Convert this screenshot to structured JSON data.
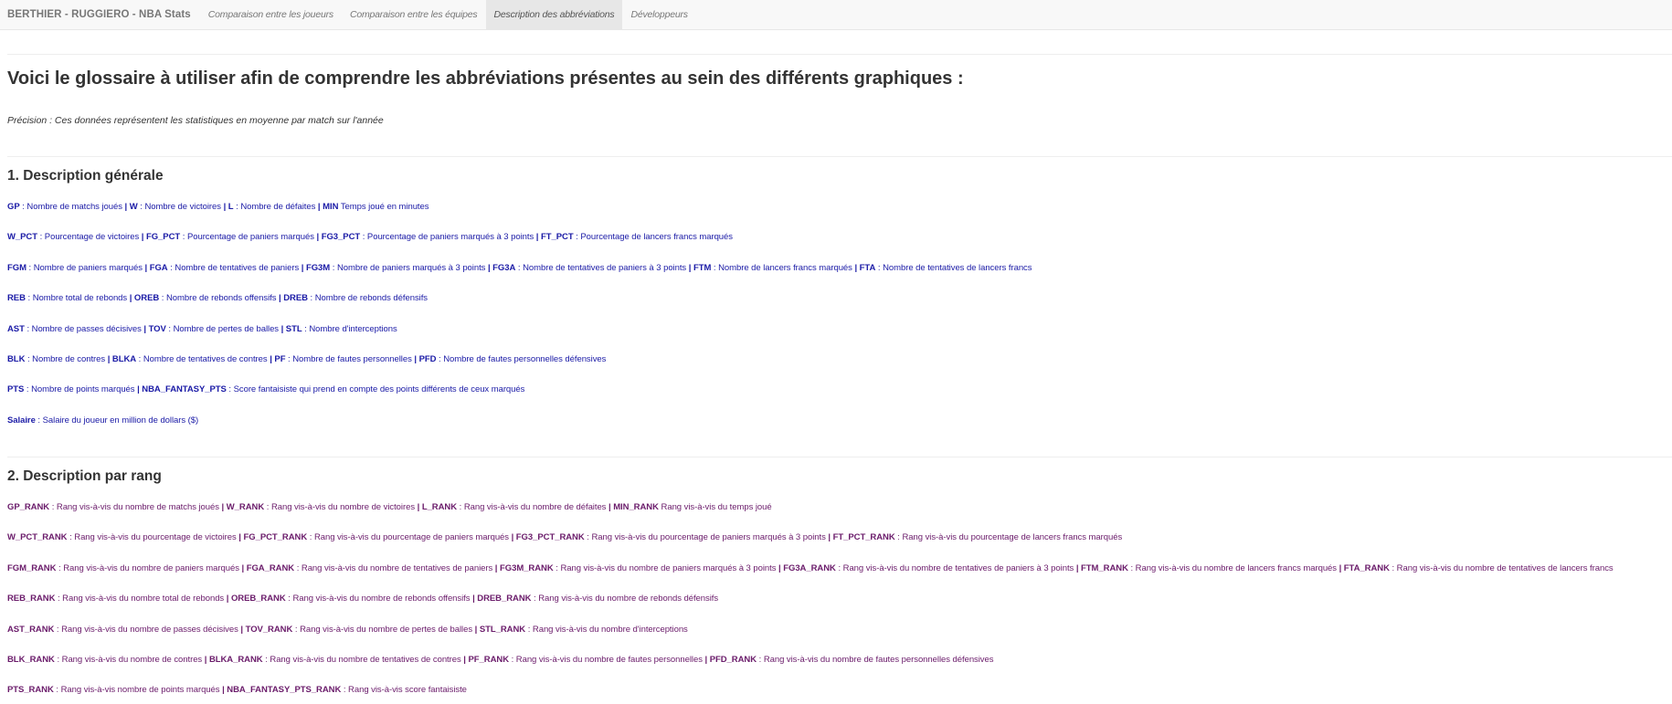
{
  "navbar": {
    "brand": "BERTHIER - RUGGIERO - NBA Stats",
    "tabs": [
      {
        "label": "Comparaison entre les joueurs",
        "active": false
      },
      {
        "label": "Comparaison entre les équipes",
        "active": false
      },
      {
        "label": "Description des abbréviations",
        "active": true
      },
      {
        "label": "Développeurs",
        "active": false
      }
    ]
  },
  "page": {
    "title": "Voici le glossaire à utiliser afin de comprendre les abbréviations présentes au sein des différents graphiques :",
    "precision": "Précision : Ces données représentent les statistiques en moyenne par match sur l'année"
  },
  "section1": {
    "title": "1. Description générale",
    "lines": [
      [
        {
          "abbr": "GP",
          "sep": " : ",
          "desc": "Nombre de matchs joués"
        },
        {
          "abbr": "W",
          "sep": " : ",
          "desc": "Nombre de victoires"
        },
        {
          "abbr": "L",
          "sep": " : ",
          "desc": "Nombre de défaites"
        },
        {
          "abbr": "MIN",
          "sep": " ",
          "desc": "Temps joué en minutes"
        }
      ],
      [
        {
          "abbr": "W_PCT",
          "sep": " : ",
          "desc": "Pourcentage de victoires"
        },
        {
          "abbr": "FG_PCT",
          "sep": " : ",
          "desc": "Pourcentage de paniers marqués"
        },
        {
          "abbr": "FG3_PCT",
          "sep": " : ",
          "desc": "Pourcentage de paniers marqués à 3 points"
        },
        {
          "abbr": "FT_PCT",
          "sep": " : ",
          "desc": "Pourcentage de lancers francs marqués"
        }
      ],
      [
        {
          "abbr": "FGM",
          "sep": " : ",
          "desc": "Nombre de paniers marqués"
        },
        {
          "abbr": "FGA",
          "sep": " : ",
          "desc": "Nombre de tentatives de paniers"
        },
        {
          "abbr": "FG3M",
          "sep": " : ",
          "desc": "Nombre de paniers marqués à 3 points"
        },
        {
          "abbr": "FG3A",
          "sep": " : ",
          "desc": "Nombre de tentatives de paniers à 3 points"
        },
        {
          "abbr": "FTM",
          "sep": " : ",
          "desc": "Nombre de lancers francs marqués"
        },
        {
          "abbr": "FTA",
          "sep": " : ",
          "desc": "Nombre de tentatives de lancers francs"
        }
      ],
      [
        {
          "abbr": "REB",
          "sep": " : ",
          "desc": "Nombre total de rebonds"
        },
        {
          "abbr": "OREB",
          "sep": " : ",
          "desc": "Nombre de rebonds offensifs"
        },
        {
          "abbr": "DREB",
          "sep": " : ",
          "desc": "Nombre de rebonds défensifs"
        }
      ],
      [
        {
          "abbr": "AST",
          "sep": " : ",
          "desc": "Nombre de passes décisives"
        },
        {
          "abbr": "TOV",
          "sep": " : ",
          "desc": "Nombre de pertes de balles"
        },
        {
          "abbr": "STL",
          "sep": " : ",
          "desc": "Nombre d'interceptions"
        }
      ],
      [
        {
          "abbr": "BLK",
          "sep": " : ",
          "desc": "Nombre de contres"
        },
        {
          "abbr": "BLKA",
          "sep": " : ",
          "desc": "Nombre de tentatives de contres"
        },
        {
          "abbr": "PF",
          "sep": " : ",
          "desc": "Nombre de fautes personnelles"
        },
        {
          "abbr": "PFD",
          "sep": " : ",
          "desc": "Nombre de fautes personnelles défensives"
        }
      ],
      [
        {
          "abbr": "PTS",
          "sep": " : ",
          "desc": "Nombre de points marqués"
        },
        {
          "abbr": "NBA_FANTASY_PTS",
          "sep": " : ",
          "desc": "Score fantaisiste qui prend en compte des points différents de ceux marqués"
        }
      ],
      [
        {
          "abbr": "Salaire",
          "sep": " : ",
          "desc": "Salaire du joueur en million de dollars ($)"
        }
      ]
    ]
  },
  "section2": {
    "title": "2. Description par rang",
    "lines": [
      [
        {
          "abbr": "GP_RANK",
          "sep": " : ",
          "desc": "Rang vis-à-vis du nombre de matchs joués"
        },
        {
          "abbr": "W_RANK",
          "sep": " : ",
          "desc": "Rang vis-à-vis du nombre de victoires"
        },
        {
          "abbr": "L_RANK",
          "sep": " : ",
          "desc": "Rang vis-à-vis du nombre de défaites"
        },
        {
          "abbr": "MIN_RANK",
          "sep": " ",
          "desc": "Rang vis-à-vis du temps joué"
        }
      ],
      [
        {
          "abbr": "W_PCT_RANK",
          "sep": " : ",
          "desc": "Rang vis-à-vis du pourcentage de victoires"
        },
        {
          "abbr": "FG_PCT_RANK",
          "sep": " : ",
          "desc": "Rang vis-à-vis du pourcentage de paniers marqués"
        },
        {
          "abbr": "FG3_PCT_RANK",
          "sep": " : ",
          "desc": "Rang vis-à-vis du pourcentage de paniers marqués à 3 points"
        },
        {
          "abbr": "FT_PCT_RANK",
          "sep": " : ",
          "desc": "Rang vis-à-vis du pourcentage de lancers francs marqués"
        }
      ],
      [
        {
          "abbr": "FGM_RANK",
          "sep": " : ",
          "desc": "Rang vis-à-vis du nombre de paniers marqués"
        },
        {
          "abbr": "FGA_RANK",
          "sep": " : ",
          "desc": "Rang vis-à-vis du nombre de tentatives de paniers"
        },
        {
          "abbr": "FG3M_RANK",
          "sep": " : ",
          "desc": "Rang vis-à-vis du nombre de paniers marqués à 3 points"
        },
        {
          "abbr": "FG3A_RANK",
          "sep": " : ",
          "desc": "Rang vis-à-vis du nombre de tentatives de paniers à 3 points"
        },
        {
          "abbr": "FTM_RANK",
          "sep": " : ",
          "desc": "Rang vis-à-vis du nombre de lancers francs marqués"
        },
        {
          "abbr": "FTA_RANK",
          "sep": " : ",
          "desc": "Rang vis-à-vis du nombre de tentatives de lancers francs"
        }
      ],
      [
        {
          "abbr": "REB_RANK",
          "sep": " : ",
          "desc": "Rang vis-à-vis du nombre total de rebonds"
        },
        {
          "abbr": "OREB_RANK",
          "sep": " : ",
          "desc": "Rang vis-à-vis du nombre de rebonds offensifs"
        },
        {
          "abbr": "DREB_RANK",
          "sep": " : ",
          "desc": "Rang vis-à-vis du nombre de rebonds défensifs"
        }
      ],
      [
        {
          "abbr": "AST_RANK",
          "sep": " : ",
          "desc": "Rang vis-à-vis du nombre de passes décisives"
        },
        {
          "abbr": "TOV_RANK",
          "sep": " : ",
          "desc": "Rang vis-à-vis du nombre de pertes de balles"
        },
        {
          "abbr": "STL_RANK",
          "sep": " : ",
          "desc": "Rang vis-à-vis du nombre d'interceptions"
        }
      ],
      [
        {
          "abbr": "BLK_RANK",
          "sep": " : ",
          "desc": "Rang vis-à-vis du nombre de contres"
        },
        {
          "abbr": "BLKA_RANK",
          "sep": " : ",
          "desc": "Rang vis-à-vis du nombre de tentatives de contres"
        },
        {
          "abbr": "PF_RANK",
          "sep": " : ",
          "desc": "Rang vis-à-vis du nombre de fautes personnelles"
        },
        {
          "abbr": "PFD_RANK",
          "sep": " : ",
          "desc": "Rang vis-à-vis du nombre de fautes personnelles défensives"
        }
      ],
      [
        {
          "abbr": "PTS_RANK",
          "sep": " : ",
          "desc": "Rang vis-à-vis nombre de points marqués"
        },
        {
          "abbr": "NBA_FANTASY_PTS_RANK",
          "sep": " : ",
          "desc": "Rang vis-à-vis score fantaisiste"
        }
      ]
    ]
  },
  "colors": {
    "section1_text": "#1a1aa6",
    "section2_text": "#6a1b6a",
    "navbar_bg": "#f8f8f8",
    "active_tab_bg": "#e7e7e7"
  }
}
